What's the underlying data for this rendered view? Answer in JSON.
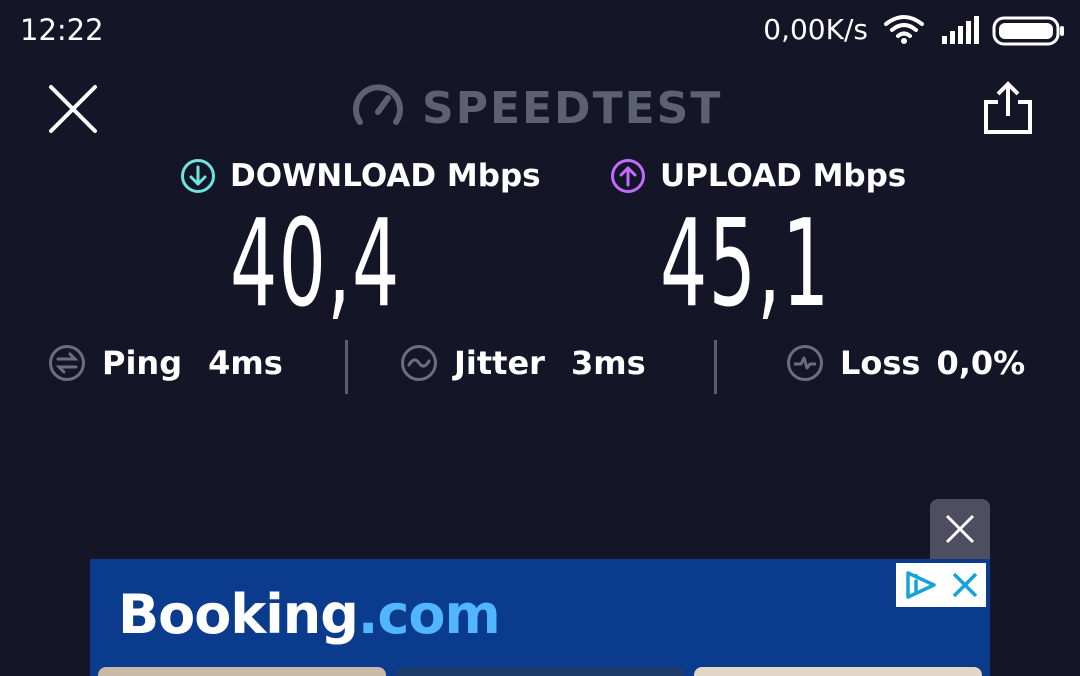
{
  "status_bar": {
    "time": "12:22",
    "net_speed": "0,00K/s",
    "icons": [
      "wifi-icon",
      "signal-icon",
      "battery-icon"
    ]
  },
  "header": {
    "brand": "SPEEDTEST",
    "icons": [
      "close-icon",
      "speedometer-icon",
      "share-icon"
    ]
  },
  "download": {
    "label": "DOWNLOAD Mbps",
    "value": "40,4",
    "accent": "#6fe3e1"
  },
  "upload": {
    "label": "UPLOAD Mbps",
    "value": "45,1",
    "accent": "#c26bff"
  },
  "stats": {
    "ping": {
      "label": "Ping",
      "value": "4ms"
    },
    "jitter": {
      "label": "Jitter",
      "value": "3ms"
    },
    "loss": {
      "label": "Loss",
      "value": "0,0%"
    }
  },
  "ad": {
    "brand_main": "Booking",
    "brand_suffix": ".com",
    "brand_color": "#0b3b8c",
    "icons": [
      "ad-close-icon",
      "adchoices-icon"
    ]
  }
}
